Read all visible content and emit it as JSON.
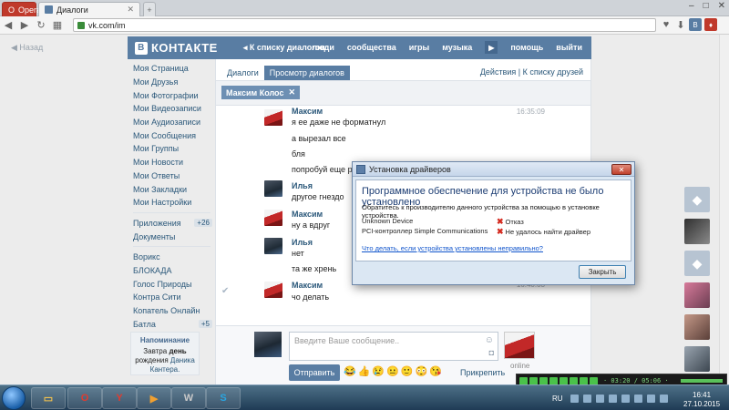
{
  "browser": {
    "tabs": [
      {
        "label": "Opera"
      },
      {
        "label": "Диалоги"
      }
    ],
    "url": "vk.com/im",
    "window_controls": [
      "–",
      "□",
      "✕"
    ]
  },
  "page": {
    "back_link": "Назад",
    "logo_text": "КОНТАКТЕ",
    "logo_badge": "В",
    "back_to_dialogs": "К списку диалогов",
    "top_menu": [
      "люди",
      "сообщества",
      "игры",
      "музыка",
      "помощь",
      "выйти"
    ]
  },
  "left_menu": {
    "items": [
      {
        "label": "Моя Страница"
      },
      {
        "label": "Мои Друзья"
      },
      {
        "label": "Мои Фотографии"
      },
      {
        "label": "Мои Видеозаписи"
      },
      {
        "label": "Мои Аудиозаписи"
      },
      {
        "label": "Мои Сообщения"
      },
      {
        "label": "Мои Группы"
      },
      {
        "label": "Мои Новости"
      },
      {
        "label": "Мои Ответы"
      },
      {
        "label": "Мои Закладки"
      },
      {
        "label": "Мои Настройки"
      }
    ],
    "apps": [
      {
        "label": "Приложения",
        "count": "+26"
      },
      {
        "label": "Документы",
        "count": ""
      }
    ],
    "groups": [
      {
        "label": "Ворикс",
        "count": ""
      },
      {
        "label": "БЛОКАДА",
        "count": ""
      },
      {
        "label": "Голос Природы",
        "count": ""
      },
      {
        "label": "Контра Сити",
        "count": ""
      },
      {
        "label": "Копатель Онлайн",
        "count": ""
      },
      {
        "label": "Батла",
        "count": "+5"
      }
    ],
    "reminder": {
      "title": "Напоминание",
      "line1": "Завтра",
      "bold": "день",
      "line2": "рождения",
      "name": "Даника Кантера."
    }
  },
  "dialogs": {
    "tabs": [
      "Диалоги",
      "Просмотр диалогов"
    ],
    "right_links": "Действия | К списку друзей",
    "peer_chip": "Максим Колос",
    "messages": [
      {
        "author": "Максим",
        "time": "16:35:09",
        "lines": [
          "я ее даже не форматнул",
          "а вырезал все",
          "бля",
          "попробуй еще ра"
        ]
      },
      {
        "author": "Илья",
        "time": "",
        "lines": [
          "другое гнездо"
        ]
      },
      {
        "author": "Максим",
        "time": "",
        "lines": [
          "ну а вдруг"
        ]
      },
      {
        "author": "Илья",
        "time": "",
        "lines": [
          "нет",
          "та же хрень"
        ]
      },
      {
        "author": "Максим",
        "time": "16:40:03",
        "lines": [
          "чо делать"
        ]
      }
    ],
    "composer": {
      "placeholder": "Введите Ваше сообщение..",
      "send": "Отправить",
      "attach": "Прикрепить",
      "status": "online"
    }
  },
  "dialog": {
    "title": "Установка драйверов",
    "heading": "Программное обеспечение для устройства не было установлено",
    "hint": "Обратитесь к производителю данного устройства за помощью в установке устройства.",
    "devices": [
      {
        "name": "Unknown Device",
        "status": "Отказ"
      },
      {
        "name": "PCI-контроллер Simple Communications",
        "status": "Не удалось найти драйвер"
      }
    ],
    "link": "Что делать, если устройства установлены неправильно?",
    "close": "Закрыть"
  },
  "taskbar": {
    "lang": "RU",
    "time": "16:41",
    "date": "27.10.2015",
    "player_display": "· 03:20 / 05:06 ·"
  },
  "colors": {
    "vk_blue": "#597da3",
    "link": "#2b587a",
    "error_red": "#d42a1f"
  }
}
